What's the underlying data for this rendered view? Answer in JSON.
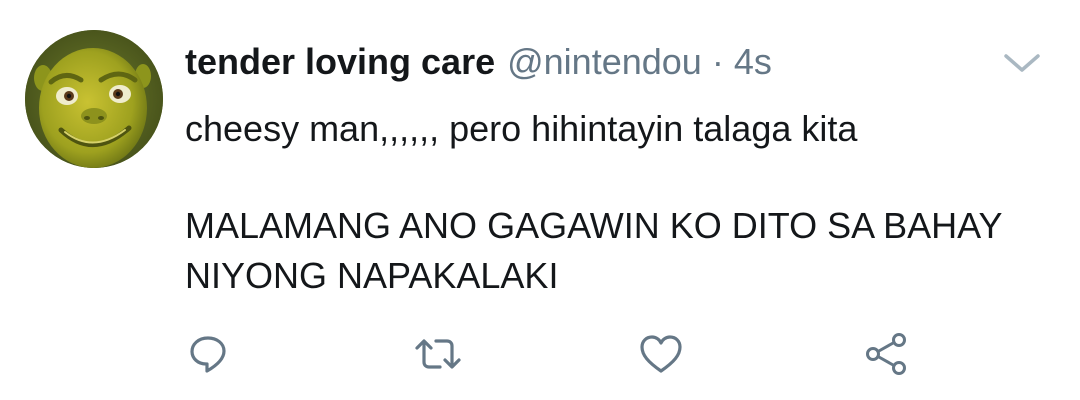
{
  "tweet": {
    "display_name": "tender loving care",
    "handle": "@nintendou",
    "separator": "·",
    "time": "4s",
    "text_line_1": "cheesy man,,,,,, pero hihintayin talaga kita",
    "text_line_2": "MALAMANG ANO GAGAWIN KO DITO SA BAHAY",
    "text_line_3": "NIYONG NAPAKALAKI"
  },
  "icons": {
    "avatar": "shrek-avatar",
    "menu": "chevron-down-icon",
    "reply": "reply-icon",
    "retweet": "retweet-icon",
    "like": "heart-icon",
    "share": "share-icon"
  },
  "colors": {
    "text": "#14171a",
    "secondary": "#657786",
    "icon": "#657786",
    "caret": "#aab8c2"
  }
}
